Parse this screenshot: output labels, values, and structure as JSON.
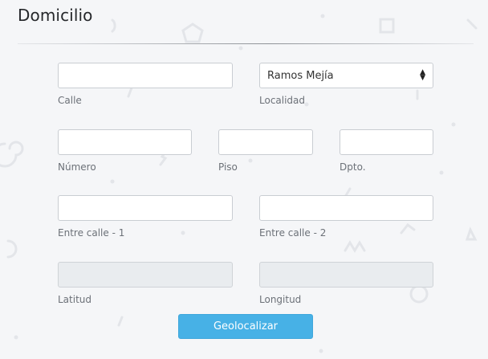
{
  "section": {
    "title": "Domicilio"
  },
  "fields": {
    "calle": {
      "label": "Calle",
      "value": ""
    },
    "localidad": {
      "label": "Localidad",
      "selected": "Ramos Mejía"
    },
    "numero": {
      "label": "Número",
      "value": ""
    },
    "piso": {
      "label": "Piso",
      "value": ""
    },
    "dpto": {
      "label": "Dpto.",
      "value": ""
    },
    "entre1": {
      "label": "Entre calle - 1",
      "value": ""
    },
    "entre2": {
      "label": "Entre calle - 2",
      "value": ""
    },
    "latitud": {
      "label": "Latitud",
      "value": ""
    },
    "longitud": {
      "label": "Longitud",
      "value": ""
    }
  },
  "actions": {
    "geolocate_label": "Geolocalizar"
  },
  "colors": {
    "primary_button": "#47b1e6",
    "background": "#f5f6f8",
    "disabled_input": "#e9ecef"
  },
  "icons": {
    "select_arrows": "sort-arrows-icon"
  }
}
